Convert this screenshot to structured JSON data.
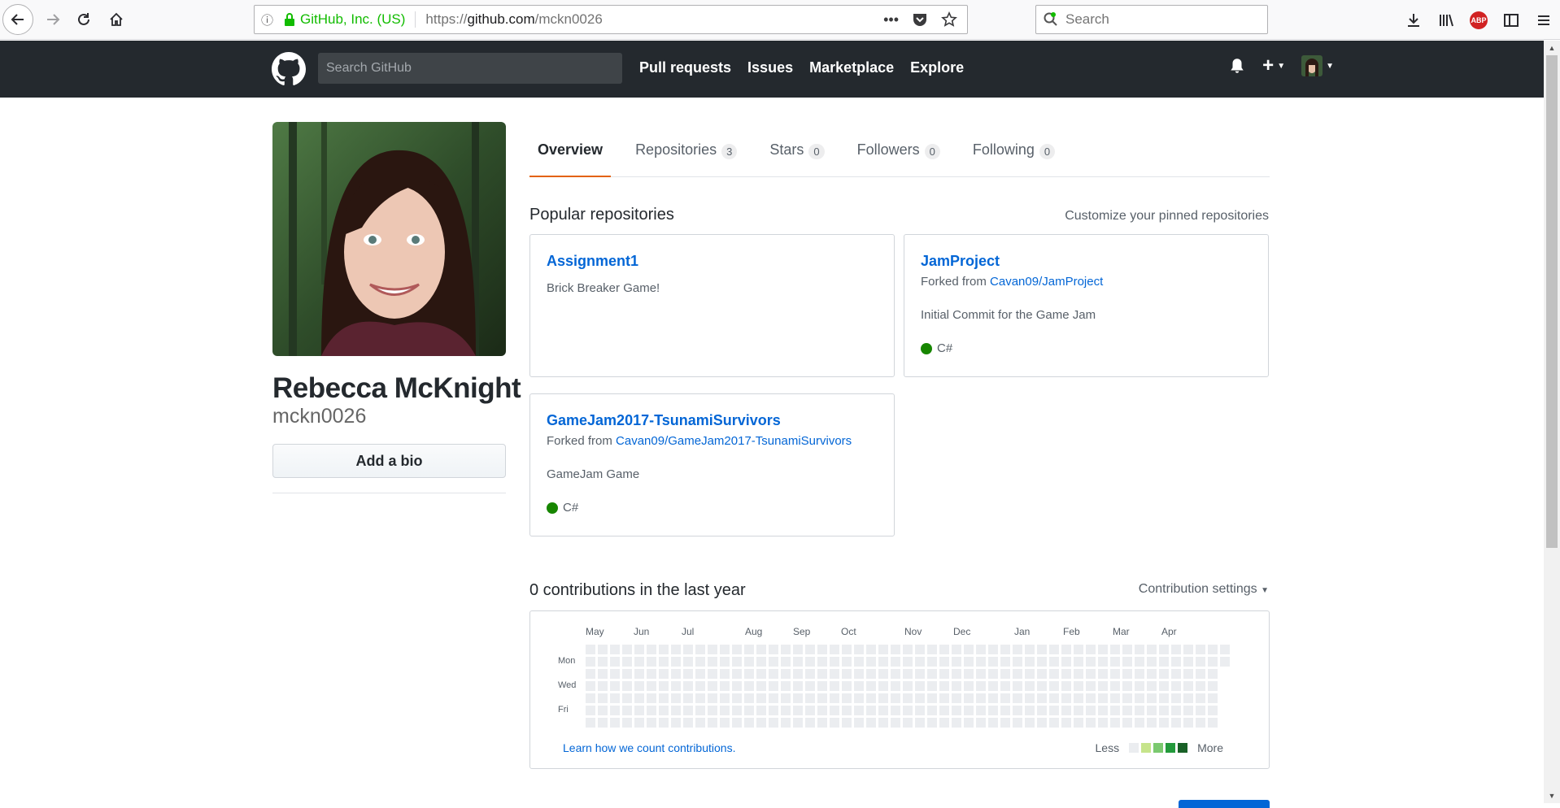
{
  "browser": {
    "identity": "GitHub, Inc. (US)",
    "url_prefix": "https://",
    "url_host": "github.com",
    "url_path": "/mckn0026",
    "search_placeholder": "Search"
  },
  "header": {
    "search_placeholder": "Search GitHub",
    "nav": [
      "Pull requests",
      "Issues",
      "Marketplace",
      "Explore"
    ]
  },
  "profile": {
    "full_name": "Rebecca McKnight",
    "username": "mckn0026",
    "bio_button": "Add a bio"
  },
  "tabs": [
    {
      "label": "Overview",
      "count": null
    },
    {
      "label": "Repositories",
      "count": "3"
    },
    {
      "label": "Stars",
      "count": "0"
    },
    {
      "label": "Followers",
      "count": "0"
    },
    {
      "label": "Following",
      "count": "0"
    }
  ],
  "popular": {
    "title": "Popular repositories",
    "customize": "Customize your pinned repositories",
    "repos": [
      {
        "name": "Assignment1",
        "description": "Brick Breaker Game!"
      },
      {
        "name": "JamProject",
        "forked_prefix": "Forked from",
        "forked_from": "Cavan09/JamProject",
        "description": "Initial Commit for the Game Jam",
        "language": "C#"
      },
      {
        "name": "GameJam2017-TsunamiSurvivors",
        "forked_prefix": "Forked from",
        "forked_from": "Cavan09/GameJam2017-TsunamiSurvivors",
        "description": "GameJam Game",
        "language": "C#"
      }
    ],
    "language_color": "#178600"
  },
  "contributions": {
    "title": "0 contributions in the last year",
    "settings": "Contribution settings",
    "months": [
      "May",
      "Jun",
      "Jul",
      "Aug",
      "Sep",
      "Oct",
      "Nov",
      "Dec",
      "Jan",
      "Feb",
      "Mar",
      "Apr"
    ],
    "days": [
      "Mon",
      "Wed",
      "Fri"
    ],
    "learn": "Learn how we count contributions.",
    "legend_less": "Less",
    "legend_more": "More",
    "legend_colors": [
      "#ebedf0",
      "#c6e48b",
      "#7bc96f",
      "#239a3b",
      "#196127"
    ]
  }
}
